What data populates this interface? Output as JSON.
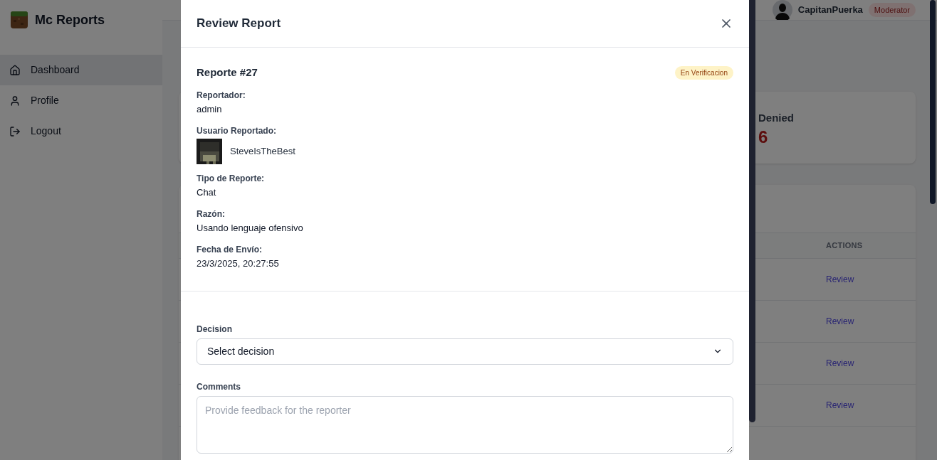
{
  "app": {
    "title": "Mc Reports"
  },
  "sidebar": {
    "items": [
      {
        "label": "Dashboard",
        "selected": true
      },
      {
        "label": "Profile",
        "selected": false
      },
      {
        "label": "Logout",
        "selected": false
      }
    ]
  },
  "user": {
    "name": "CapitanPuerka",
    "role": "Moderator"
  },
  "stats": [
    {
      "label": "Denied",
      "value": "6"
    }
  ],
  "table": {
    "columns": [
      "ACTIONS"
    ],
    "rows": [
      {
        "action": "Review"
      },
      {
        "action": "Review"
      },
      {
        "action": "Review"
      },
      {
        "action": "Review"
      }
    ]
  },
  "modal": {
    "title": "Review Report",
    "report_title": "Reporte #27",
    "status": "En Verificacion",
    "fields": [
      {
        "kind": "text",
        "label": "Reportador:",
        "value": "admin"
      },
      {
        "kind": "user",
        "label": "Usuario Reportado:",
        "value": "SteveIsTheBest"
      },
      {
        "kind": "text",
        "label": "Tipo de Reporte:",
        "value": "Chat"
      },
      {
        "kind": "text",
        "label": "Razón:",
        "value": "Usando lenguaje ofensivo"
      },
      {
        "kind": "text",
        "label": "Fecha de Envío:",
        "value": "23/3/2025, 20:27:55"
      }
    ],
    "decision": {
      "label": "Decision",
      "value": "Select decision"
    },
    "comments": {
      "label": "Comments",
      "placeholder": "Provide feedback for the reporter"
    }
  }
}
